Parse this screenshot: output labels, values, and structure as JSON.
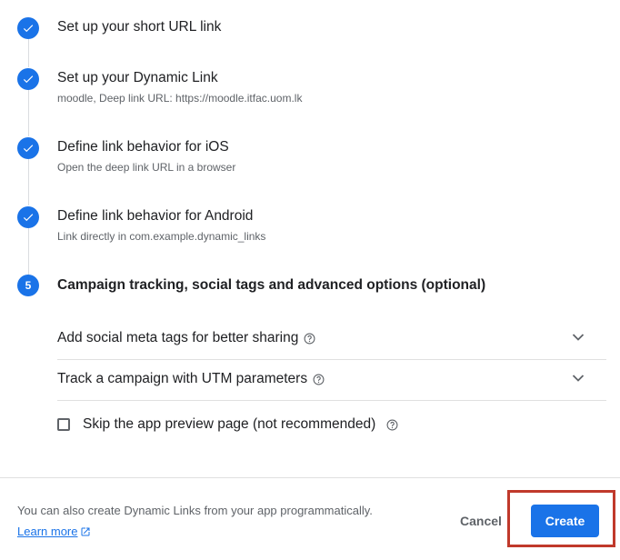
{
  "steps": [
    {
      "title": "Set up your short URL link",
      "subtitle": "",
      "status": "complete",
      "icon": "check-icon"
    },
    {
      "title": "Set up your Dynamic Link",
      "subtitle": "moodle, Deep link URL: https://moodle.itfac.uom.lk",
      "status": "complete",
      "icon": "check-icon"
    },
    {
      "title": "Define link behavior for iOS",
      "subtitle": "Open the deep link URL in a browser",
      "status": "complete",
      "icon": "check-icon"
    },
    {
      "title": "Define link behavior for Android",
      "subtitle": "Link directly in com.example.dynamic_links",
      "status": "complete",
      "icon": "check-icon"
    },
    {
      "number": "5",
      "title": "Campaign tracking, social tags and advanced options (optional)",
      "status": "active"
    }
  ],
  "advanced": {
    "social_meta": {
      "label": "Add social meta tags for better sharing",
      "icon": "help-icon",
      "expand_icon": "chevron-down-icon"
    },
    "utm": {
      "label": "Track a campaign with UTM parameters",
      "icon": "help-icon",
      "expand_icon": "chevron-down-icon"
    },
    "skip_preview": {
      "label": "Skip the app preview page (not recommended)",
      "checked": false,
      "icon": "help-icon"
    }
  },
  "footer": {
    "info_text": "You can also create Dynamic Links from your app programmatically.",
    "learn_more": "Learn more",
    "learn_more_icon": "open-in-new-icon",
    "cancel_label": "Cancel",
    "create_label": "Create"
  },
  "colors": {
    "accent": "#1a73e8",
    "highlight": "#c0392b"
  }
}
